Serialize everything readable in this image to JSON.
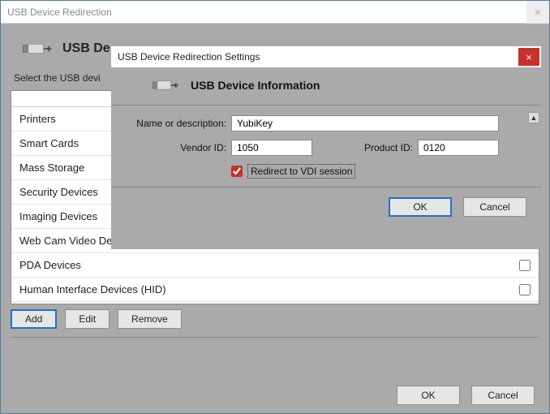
{
  "outer": {
    "title": "USB Device Redirection",
    "header_title": "USB De",
    "instruction": "Select the USB devi",
    "buttons": {
      "add": "Add",
      "edit": "Edit",
      "remove": "Remove",
      "ok": "OK",
      "cancel": "Cancel"
    },
    "devices": [
      {
        "label": "Printers",
        "checked": false
      },
      {
        "label": "Smart Cards",
        "checked": false
      },
      {
        "label": "Mass Storage",
        "checked": false
      },
      {
        "label": "Security Devices",
        "checked": false
      },
      {
        "label": "Imaging Devices",
        "checked": false
      },
      {
        "label": "Web Cam Video Devices",
        "checked": false
      },
      {
        "label": "PDA Devices",
        "checked": false
      },
      {
        "label": "Human Interface Devices (HID)",
        "checked": false
      }
    ]
  },
  "inner": {
    "title": "USB Device Redirection Settings",
    "header_title": "USB Device Information",
    "labels": {
      "name": "Name or description:",
      "vendor": "Vendor ID:",
      "product": "Product ID:",
      "redirect": "Redirect to VDI session"
    },
    "values": {
      "name": "YubiKey",
      "vendor": "1050",
      "product": "0120",
      "redirect_checked": true
    },
    "buttons": {
      "ok": "OK",
      "cancel": "Cancel"
    }
  }
}
